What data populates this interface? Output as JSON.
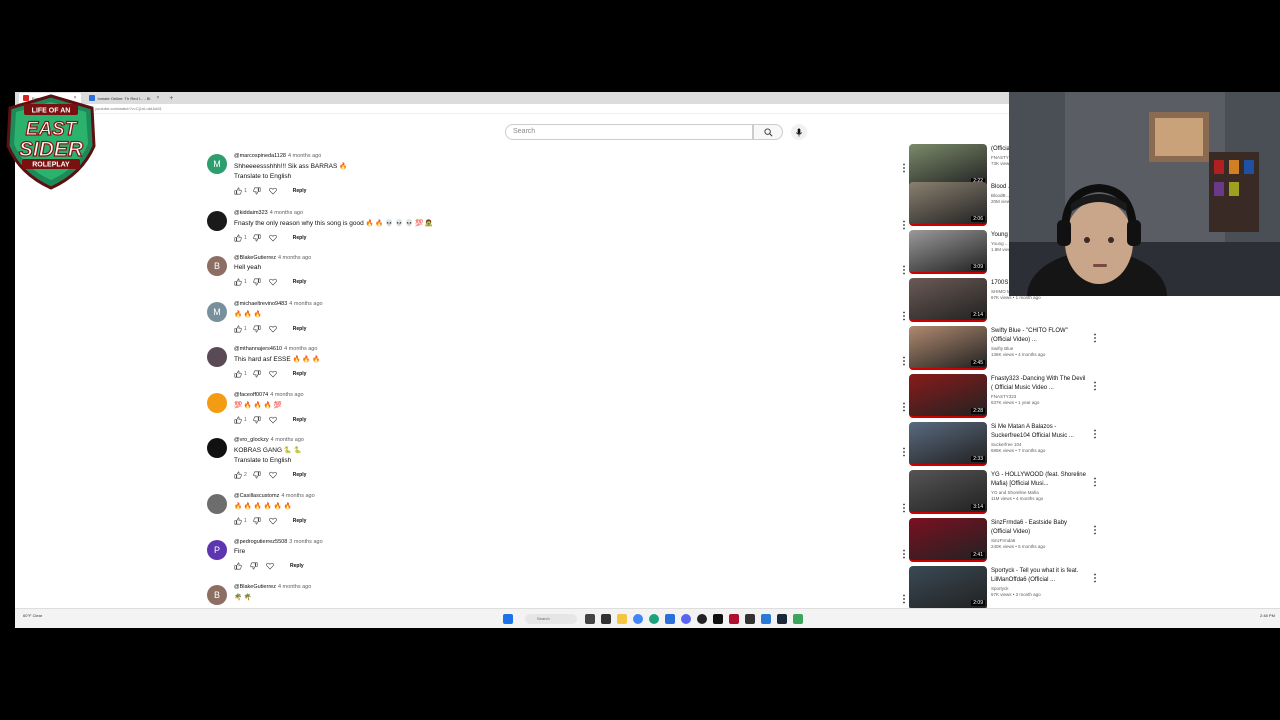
{
  "browser": {
    "tabs": [
      {
        "label": "Fnasty323 - Sixth ...",
        "active": true
      },
      {
        "label": "Inmate Online: Th Red I... - Bl",
        "active": false
      }
    ],
    "url": "youtube.com/watch?v=Cj1nLotdJuM1"
  },
  "search": {
    "placeholder": "Search"
  },
  "comments": [
    {
      "avatar_letter": "M",
      "avatar_color": "#2e9e6e",
      "user": "@marcospineda1128",
      "when": "4 months ago",
      "text": "Shheeeessshhh!!! Sik ass BARRAS 🔥",
      "translate": "Translate to English",
      "likes": "1",
      "reply": "Reply"
    },
    {
      "avatar_letter": "",
      "avatar_color": "#1a1a1a",
      "user": "@kiddaim323",
      "when": "4 months ago",
      "text": "Fnasty the only reason why this song is good 🔥 🔥 💀 💀 💀 💯 🧟",
      "translate": "",
      "likes": "1",
      "reply": "Reply"
    },
    {
      "avatar_letter": "B",
      "avatar_color": "#8d6e63",
      "user": "@BlakeGutierrez",
      "when": "4 months ago",
      "text": "Hell yeah",
      "translate": "",
      "likes": "1",
      "reply": "Reply"
    },
    {
      "avatar_letter": "M",
      "avatar_color": "#78909c",
      "user": "@michaeltrevino9483",
      "when": "4 months ago",
      "text": "🔥 🔥 🔥",
      "translate": "",
      "likes": "1",
      "reply": "Reply"
    },
    {
      "avatar_letter": "",
      "avatar_color": "#5a4a55",
      "user": "@mthannajers4610",
      "when": "4 months ago",
      "text": "This hard asf ESSE 🔥 🔥 🔥",
      "translate": "",
      "likes": "1",
      "reply": "Reply"
    },
    {
      "avatar_letter": "",
      "avatar_color": "#f39c12",
      "user": "@faceoff0074",
      "when": "4 months ago",
      "text": "💯 🔥 🔥 🔥 💯",
      "translate": "",
      "likes": "1",
      "reply": "Reply"
    },
    {
      "avatar_letter": "",
      "avatar_color": "#111111",
      "user": "@vro_glockzy",
      "when": "4 months ago",
      "text": "KOBRAS GANG 🐍 🐍",
      "translate": "Translate to English",
      "likes": "2",
      "reply": "Reply"
    },
    {
      "avatar_letter": "",
      "avatar_color": "#6d6d6d",
      "user": "@Casillascustomz",
      "when": "4 months ago",
      "text": "🔥 🔥 🔥 🔥 🔥 🔥",
      "translate": "",
      "likes": "1",
      "reply": "Reply"
    },
    {
      "avatar_letter": "P",
      "avatar_color": "#5e35b1",
      "user": "@pedrogutierrez5508",
      "when": "3 months ago",
      "text": "Fire",
      "translate": "",
      "likes": "",
      "reply": "Reply"
    },
    {
      "avatar_letter": "B",
      "avatar_color": "#8d6e63",
      "user": "@BlakeGutierrez",
      "when": "4 months ago",
      "text": "🌴 🌴",
      "translate": "",
      "likes": "",
      "reply": "Reply"
    }
  ],
  "videos": [
    {
      "title": "(Official ...",
      "channel": "FNASTY",
      "stats": "73K views",
      "duration": "2:22",
      "color": "#7a8a6a"
    },
    {
      "title": "Blood ... Saw It ...",
      "channel": "BloodB...",
      "stats": "20M views",
      "duration": "2:06",
      "color": "#8a8070"
    },
    {
      "title": "Young ... (West ...",
      "channel": "Young ...",
      "stats": "1.8M views",
      "duration": "3:09",
      "color": "#9a9a9a"
    },
    {
      "title": "1700S ... Shots ...",
      "channel": "SHIMO MEDIA",
      "stats": "67K views • 1 month ago",
      "duration": "2:14",
      "color": "#6b5a55"
    },
    {
      "title": "Swifty Blue - \"CHITO FLOW\" (Official Video) ...",
      "channel": "Swifty Blue",
      "stats": "136K views • 4 months ago",
      "duration": "2:45",
      "color": "#b08a70"
    },
    {
      "title": "Fnasty323 -Dancing With The Devil ( Official Music Video ...",
      "channel": "FNASTY323",
      "stats": "637K views • 1 year ago",
      "duration": "2:28",
      "color": "#8a1a1a"
    },
    {
      "title": "Si Me Matan A Balazos - Suckerfree104 Official Music ...",
      "channel": "Suckerfree 104",
      "stats": "685K views • 7 months ago",
      "duration": "2:33",
      "color": "#5a6a80"
    },
    {
      "title": "YG - HOLLYWOOD (feat. Shoreline Mafia) [Official Musi...",
      "channel": "YG and Shoreline Mafia",
      "stats": "11M views • 4 months ago",
      "duration": "3:14",
      "color": "#555555"
    },
    {
      "title": "SinzFrmda6 - Eastside Baby (Official Video)",
      "channel": "SinzFrmda6",
      "stats": "240K views • 5 months ago",
      "duration": "2:41",
      "color": "#7a1020"
    },
    {
      "title": "Sportyck - Tell you what it is feat. LilManOffda6 (Official ...",
      "channel": "Sportyck",
      "stats": "57K views • 3 month ago",
      "duration": "2:09",
      "color": "#3a4a55"
    }
  ],
  "taskbar": {
    "search_label": "Search",
    "weather": "60°F Clear",
    "clock": "2:48 PM"
  },
  "overlay": {
    "logo_top": "LIFE OF AN",
    "logo_main1": "EAST",
    "logo_main2": "SIDER",
    "logo_sub": "ROLEPLAY"
  }
}
